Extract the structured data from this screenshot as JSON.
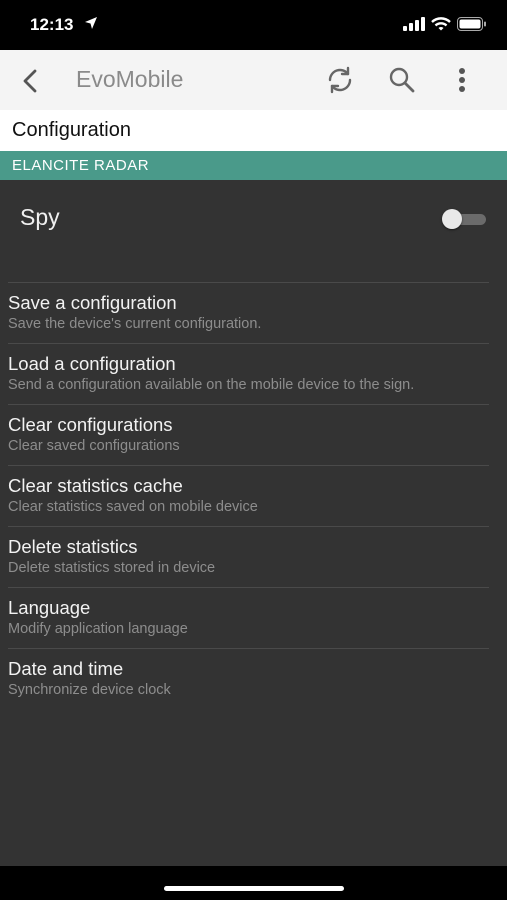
{
  "status_bar": {
    "time": "12:13",
    "icons": [
      "location-arrow-icon",
      "cellular-signal-icon",
      "wifi-icon",
      "battery-icon"
    ]
  },
  "app_bar": {
    "title": "EvoMobile",
    "icons": [
      "back-arrow-icon",
      "refresh-icon",
      "search-icon",
      "more-vertical-icon"
    ],
    "background": "#f4f4f4",
    "title_color": "#8a8a8a"
  },
  "page": {
    "header": "Configuration",
    "section": "ELANCITE RADAR",
    "section_color": "#4a9a8a",
    "content_background": "#333333"
  },
  "spy": {
    "label": "Spy",
    "enabled": false
  },
  "menu": [
    {
      "title": "Save a configuration",
      "subtitle": "Save the device's current configuration."
    },
    {
      "title": "Load a configuration",
      "subtitle": "Send a configuration available on the mobile device to the sign."
    },
    {
      "title": "Clear configurations",
      "subtitle": "Clear saved configurations"
    },
    {
      "title": "Clear statistics cache",
      "subtitle": "Clear statistics saved on mobile device"
    },
    {
      "title": "Delete statistics",
      "subtitle": "Delete statistics stored in device"
    },
    {
      "title": "Language",
      "subtitle": "Modify application language"
    },
    {
      "title": "Date and time",
      "subtitle": "Synchronize device clock"
    }
  ]
}
